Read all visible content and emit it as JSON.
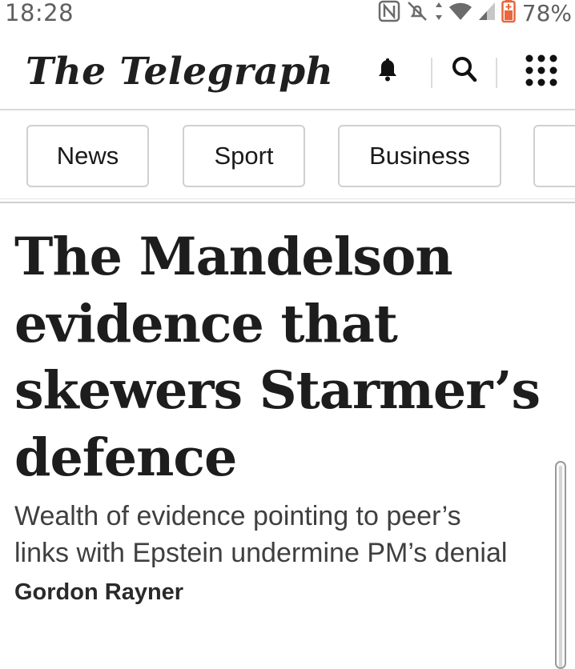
{
  "status": {
    "time": "18:28",
    "battery": "78%",
    "icons": [
      "nfc-icon",
      "mute-icon",
      "data-arrows-icon",
      "wifi-icon",
      "signal-icon",
      "battery-icon"
    ]
  },
  "header": {
    "logo": "The Telegraph",
    "icons": [
      "bell-icon",
      "search-icon",
      "grid-menu-icon"
    ]
  },
  "nav": {
    "items": [
      "News",
      "Sport",
      "Business"
    ]
  },
  "article": {
    "headline_lines": [
      "The Mandelson",
      "evidence that",
      "skewers Starmer’s",
      "defence"
    ],
    "standfirst_lines": [
      "Wealth of evidence pointing to peer’s",
      "links with Epstein undermine PM’s denial"
    ],
    "byline": "Gordon Rayner"
  },
  "colors": {
    "text": "#1a1a1a",
    "border": "#d0d0d0",
    "status_grey": "#5f5f5f",
    "battery_warning": "#e8673c"
  }
}
